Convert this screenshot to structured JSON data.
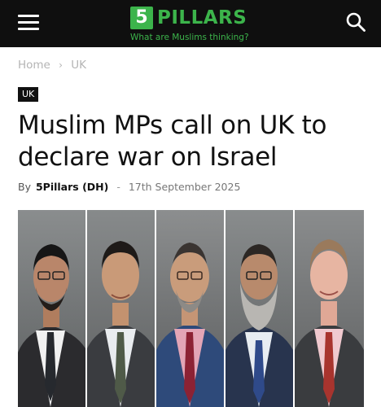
{
  "header": {
    "logo_number": "5",
    "logo_word": "PILLARS",
    "tagline": "What are Muslims thinking?",
    "menu_icon": "hamburger-menu-icon",
    "search_icon": "search-icon",
    "background_color": "#0f0f0f",
    "brand_color": "#3cb44b"
  },
  "breadcrumb": {
    "items": [
      "Home",
      "UK"
    ],
    "separator": "›"
  },
  "article": {
    "category": "UK",
    "title": "Muslim MPs call on UK to declare war on Israel",
    "by_label": "By",
    "author": "5Pillars (DH)",
    "separator": "-",
    "date": "17th September 2025"
  }
}
